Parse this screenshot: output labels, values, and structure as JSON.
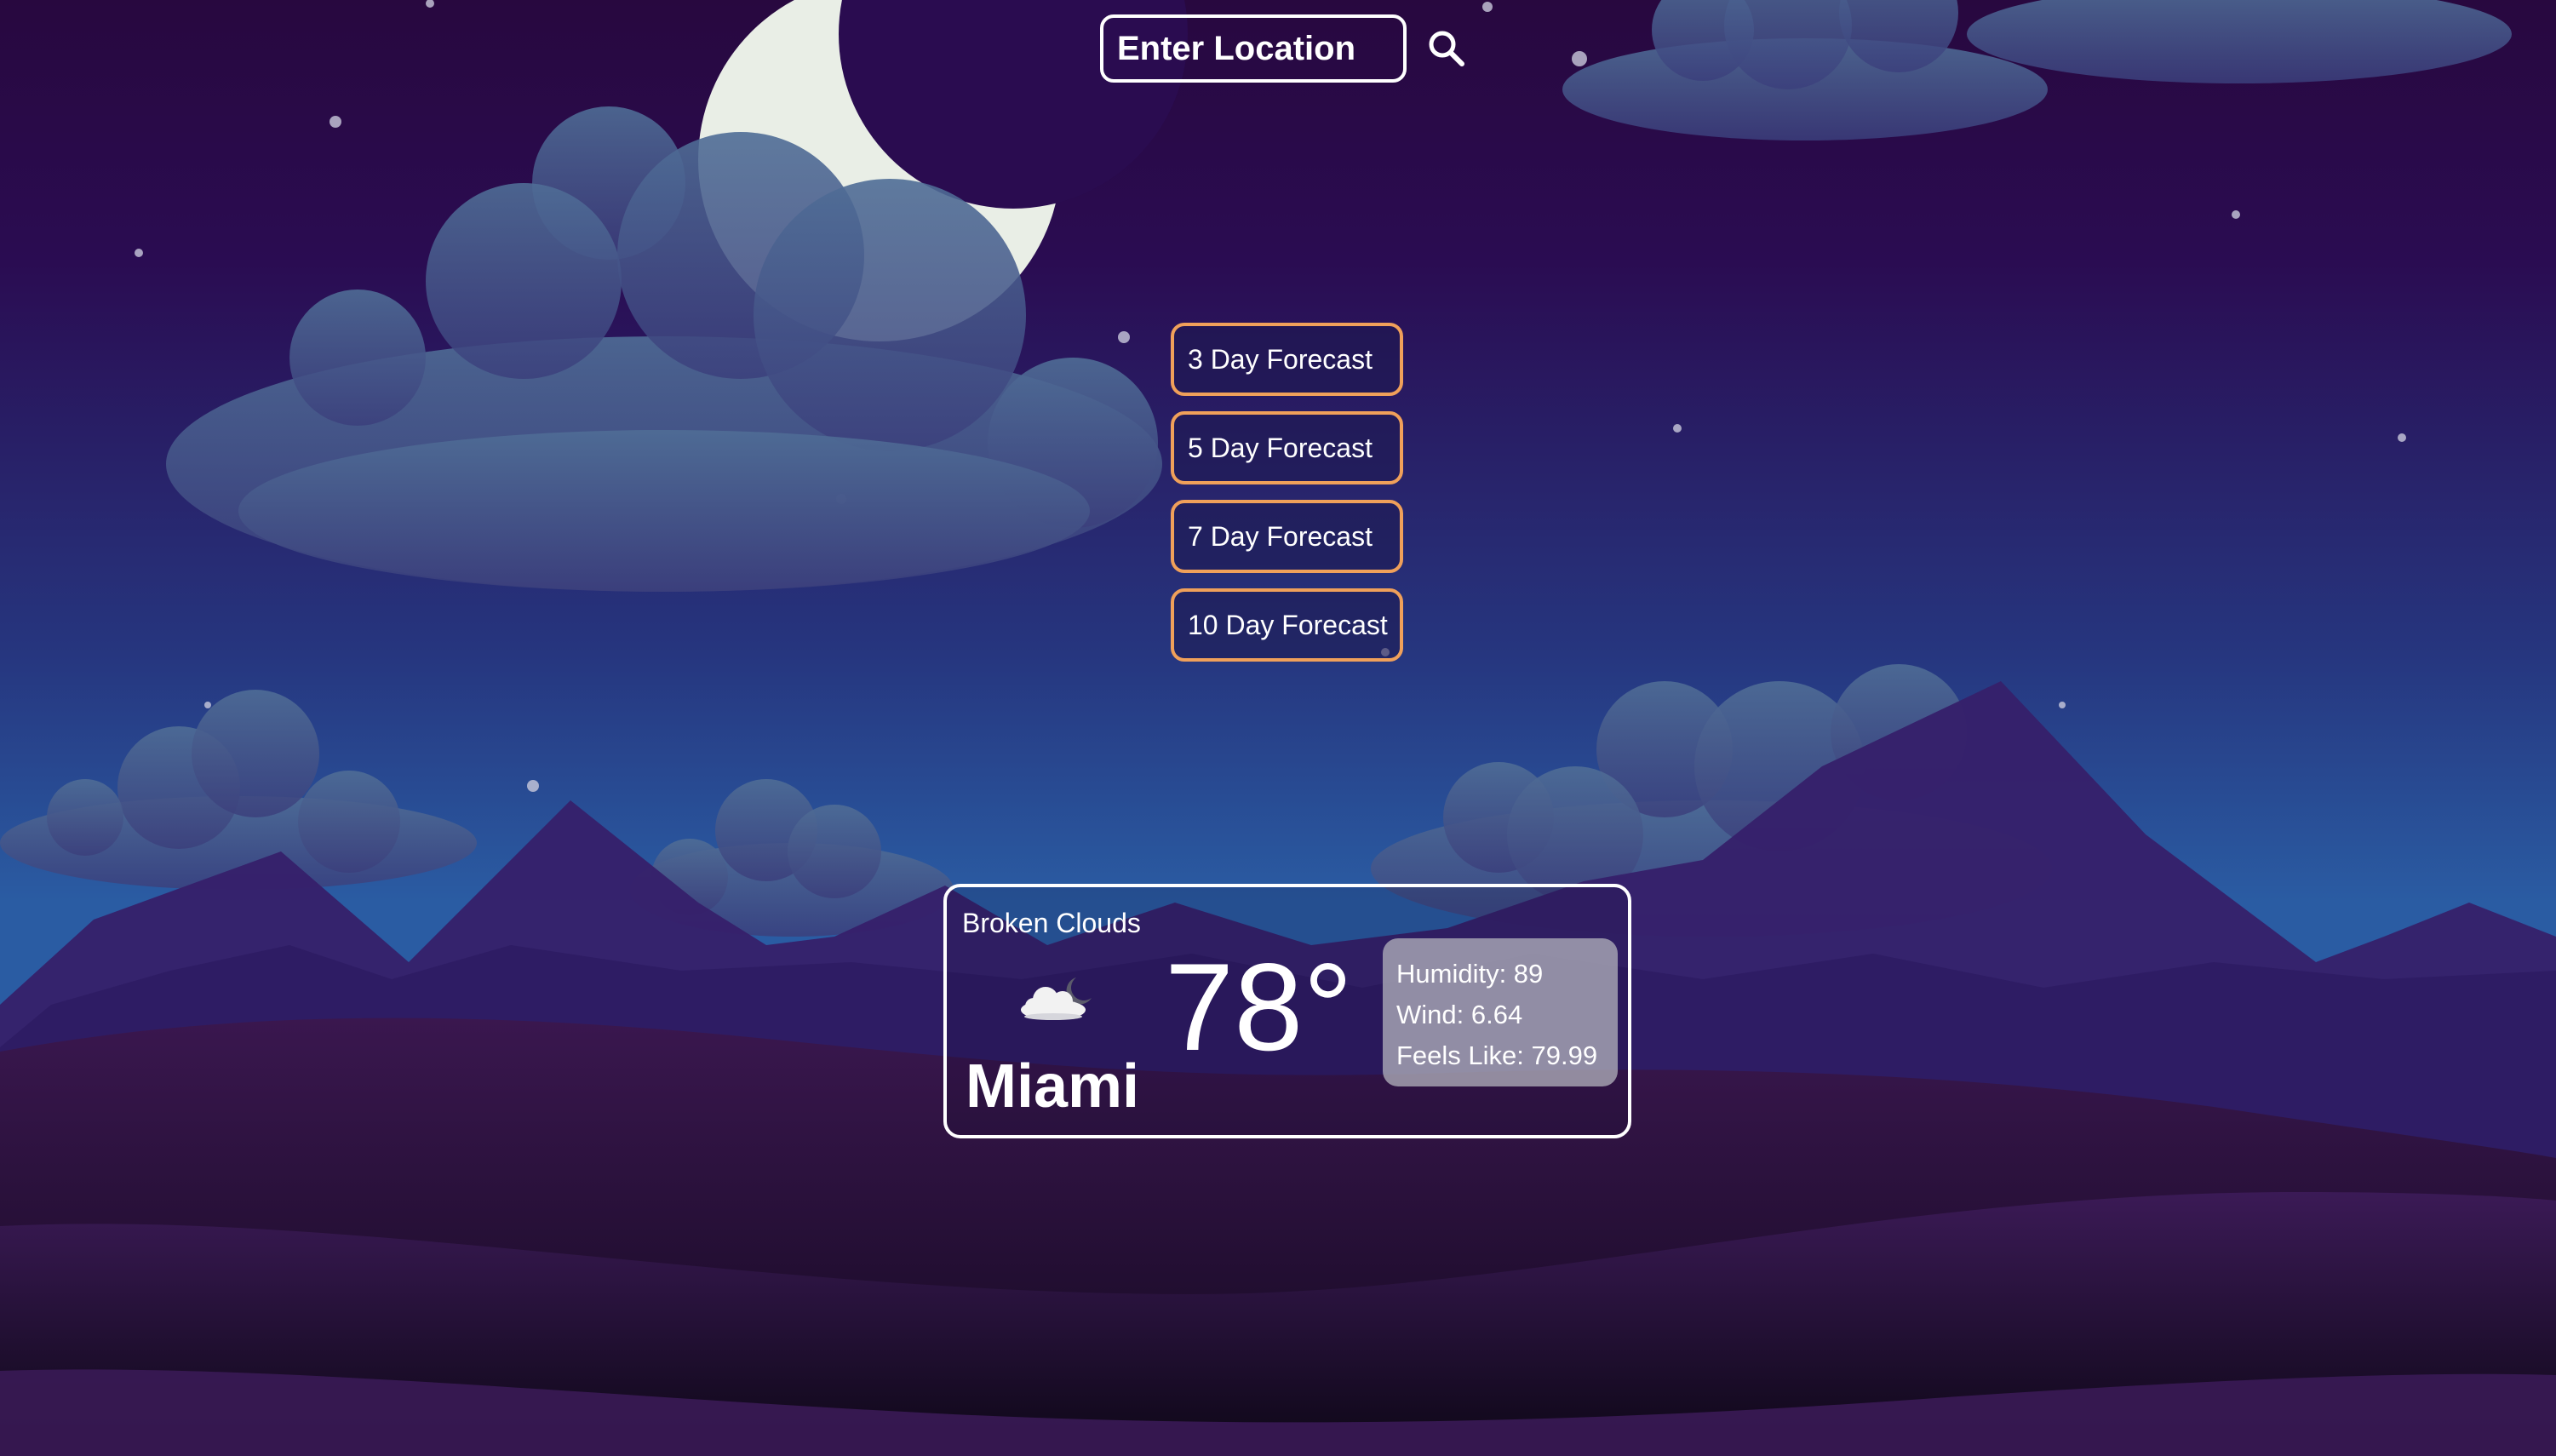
{
  "search": {
    "placeholder": "Enter Location",
    "icon": "search-icon"
  },
  "forecast_buttons": [
    {
      "label": "3 Day Forecast"
    },
    {
      "label": "5 Day Forecast"
    },
    {
      "label": "7 Day Forecast"
    },
    {
      "label": "10 Day Forecast"
    }
  ],
  "weather": {
    "condition": "Broken Clouds",
    "icon": "cloud-moon-icon",
    "temperature": "78°",
    "city": "Miami",
    "humidity": "Humidity: 89",
    "wind": "Wind: 6.64",
    "feels_like": "Feels Like: 79.99"
  },
  "colors": {
    "sky_top": "#2a0a4a",
    "sky_bottom": "#2a5ca3",
    "button_border": "#f0a05a",
    "mountains": "#36206a",
    "hills": "#3a1550"
  }
}
